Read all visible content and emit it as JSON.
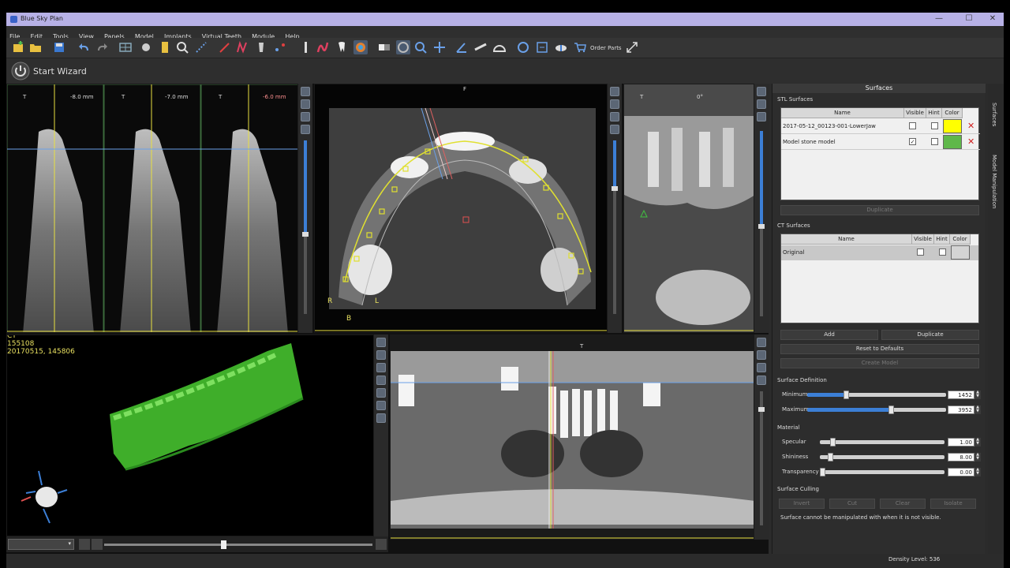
{
  "app": {
    "title": "Blue Sky Plan"
  },
  "window_controls": {
    "minimize": "—",
    "maximize": "☐",
    "close": "✕"
  },
  "menu": [
    "File",
    "Edit",
    "Tools",
    "View",
    "Panels",
    "Model",
    "Implants",
    "Virtual Teeth",
    "Module",
    "Help"
  ],
  "toolbar": {
    "order_parts_label": "Order Parts"
  },
  "wizard": {
    "label": "Start Wizard"
  },
  "cross_sections": [
    {
      "label": "-8.0 mm",
      "color": "#a0a0ff"
    },
    {
      "label": "-7.0 mm",
      "color": "#dddddd"
    },
    {
      "label": "-6.0 mm",
      "color": "#ff9090"
    }
  ],
  "axial": {
    "top_label": "F",
    "bottom_label": "B",
    "left_label": "R",
    "right_label": "L"
  },
  "sagittal": {
    "top_left": "T",
    "top_right": "0°"
  },
  "panoramic": {
    "top_label": "T"
  },
  "view3d": {
    "line1": "CT",
    "line2": "155108",
    "line3": "20170515, 145806"
  },
  "panel": {
    "title": "Surfaces",
    "stl_section": "STL Surfaces",
    "stl_headers": [
      "Name",
      "Visible",
      "Hint",
      "Color"
    ],
    "stl_rows": [
      {
        "name": "2017-05-12_00123-001-LowerJaw",
        "visible": false,
        "hint": false,
        "color": "#ffff00"
      },
      {
        "name": "Model stone model",
        "visible": true,
        "hint": false,
        "color": "#5fb84a"
      }
    ],
    "stl_duplicate": "Duplicate",
    "ct_section": "CT Surfaces",
    "ct_headers": [
      "Name",
      "Visible",
      "Hint",
      "Color"
    ],
    "ct_rows": [
      {
        "name": "Original",
        "visible": false,
        "hint": false,
        "color": "#d4d4d4"
      }
    ],
    "add": "Add",
    "duplicate": "Duplicate",
    "reset": "Reset to Defaults",
    "create_model": "Create Model",
    "surface_definition": "Surface Definition",
    "minimum_label": "Minimum",
    "minimum_value": "1452",
    "minimum_fraction": 0.28,
    "maximum_label": "Maximum",
    "maximum_value": "3952",
    "maximum_fraction": 0.6,
    "material": "Material",
    "specular_label": "Specular",
    "specular_value": "1.00",
    "specular_fraction": 0.1,
    "shininess_label": "Shininess",
    "shininess_value": "8.00",
    "shininess_fraction": 0.08,
    "transparency_label": "Transparency",
    "transparency_value": "0.00",
    "transparency_fraction": 0.0,
    "culling": "Surface Culling",
    "invert": "Invert",
    "cut": "Cut",
    "clear": "Clear",
    "isolate": "Isolate",
    "culling_note": "Surface cannot be manipulated with when it is not visible."
  },
  "right_tabs": [
    "Surfaces",
    "Model Manipulation"
  ],
  "status": {
    "density": "Density Level: 536"
  },
  "colors": {
    "accent": "#3c7fd6",
    "yellow_curve": "#e0e030",
    "title_bar": "#b7b1e6"
  }
}
